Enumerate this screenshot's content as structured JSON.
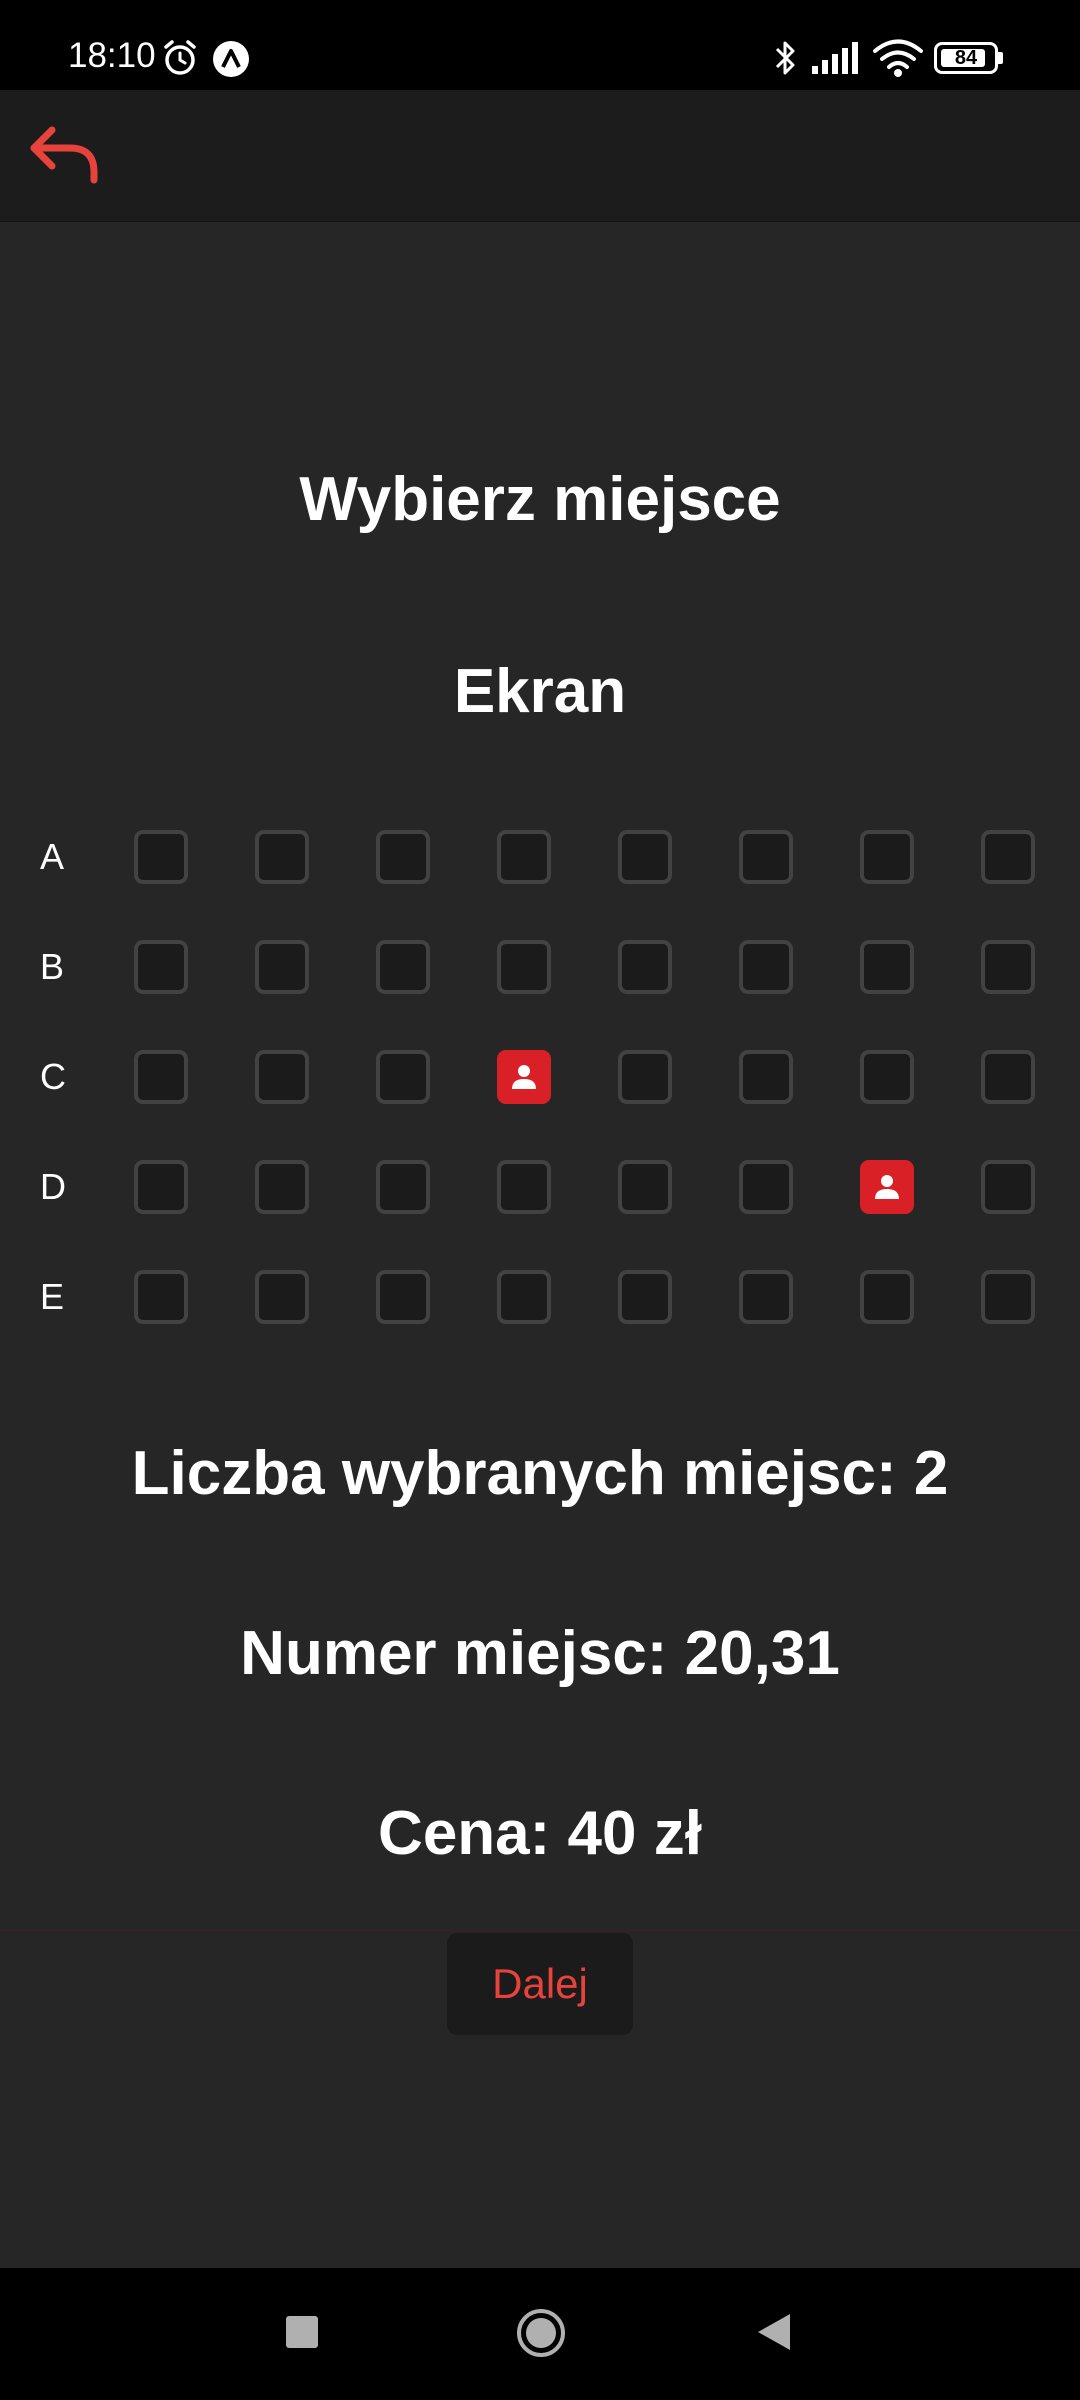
{
  "status_bar": {
    "time": "18:10",
    "battery_level": "84",
    "battery_fraction": 0.84,
    "icons": [
      "alarm-icon",
      "app-status-icon",
      "bluetooth-icon",
      "signal-icon",
      "wifi-icon",
      "battery-icon"
    ]
  },
  "header": {
    "back_icon": "back-arrow-icon",
    "accent_color": "#e8433a"
  },
  "main": {
    "title": "Wybierz miejsce",
    "screen_label": "Ekran",
    "rows": [
      {
        "label": "A",
        "seats": [
          false,
          false,
          false,
          false,
          false,
          false,
          false,
          false
        ]
      },
      {
        "label": "B",
        "seats": [
          false,
          false,
          false,
          false,
          false,
          false,
          false,
          false
        ]
      },
      {
        "label": "C",
        "seats": [
          false,
          false,
          false,
          true,
          false,
          false,
          false,
          false
        ]
      },
      {
        "label": "D",
        "seats": [
          false,
          false,
          false,
          false,
          false,
          false,
          true,
          false
        ]
      },
      {
        "label": "E",
        "seats": [
          false,
          false,
          false,
          false,
          false,
          false,
          false,
          false
        ]
      }
    ],
    "selected_seat_color": "#d92027",
    "selected_seat_icon": "person-icon",
    "seats_count": "Liczba wybranych miejsc: 2",
    "seat_numbers": "Numer miejsc: 20,31",
    "price": "Cena: 40 zł",
    "next_label": "Dalej"
  },
  "nav_bar": {
    "icons": [
      "recent-apps-icon",
      "home-icon",
      "back-icon"
    ]
  }
}
